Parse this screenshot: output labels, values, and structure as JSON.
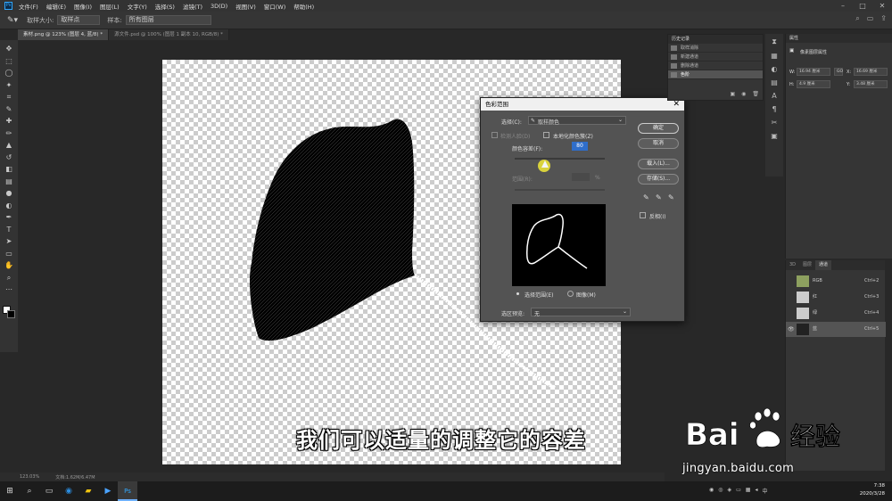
{
  "app": {
    "logo": "Ps",
    "menu": [
      "文件(F)",
      "编辑(E)",
      "图像(I)",
      "图层(L)",
      "文字(Y)",
      "选择(S)",
      "滤镜(T)",
      "3D(D)",
      "视图(V)",
      "窗口(W)",
      "帮助(H)"
    ]
  },
  "options_bar": {
    "sample_size_label": "取样大小:",
    "sample_size_value": "取样点",
    "sample_label": "样本:",
    "sample_value": "所有图层"
  },
  "tabs": [
    {
      "label": "素材.png @ 123% (图层 4, 蓝/8) *",
      "active": true
    },
    {
      "label": "源文件.psd @ 100% (图层 1 副本 10, RGB/8) *",
      "active": false
    }
  ],
  "status_bar": {
    "zoom": "123.03%",
    "doc": "文档:1.62M/6.47M"
  },
  "canvas": {
    "subtitle": "我们可以适量的调整它的容差"
  },
  "dialog": {
    "title": "色彩范围",
    "select_label": "选择(C):",
    "select_value": "取样颜色",
    "detect_faces": "检测人脸(D)",
    "localized": "本地化颜色簇(Z)",
    "fuzziness_label": "颜色容差(F):",
    "fuzziness_value": "80",
    "range_label": "范围(R):",
    "range_unit": "%",
    "radio_selection": "选择范围(E)",
    "radio_image": "图像(M)",
    "preview_label": "选区预览:",
    "preview_value": "无",
    "btn_ok": "确定",
    "btn_cancel": "取消",
    "btn_load": "载入(L)...",
    "btn_save": "存储(S)...",
    "invert": "反相(I)"
  },
  "history": {
    "title": "历史记录",
    "items": [
      "取样消除",
      "新建通道",
      "删除通道",
      "色阶"
    ],
    "selected_index": 3
  },
  "properties": {
    "title": "属性",
    "subtitle": "像素图层属性",
    "w": "16.94 厘米",
    "h": "4.9 厘米",
    "x": "16.69 厘米",
    "y": "3.48 厘米",
    "link": "GO"
  },
  "channels": {
    "tabs": [
      "3D",
      "图层",
      "通道"
    ],
    "active_tab": 2,
    "rows": [
      {
        "name": "RGB",
        "shortcut": "Ctrl+2"
      },
      {
        "name": "红",
        "shortcut": "Ctrl+3"
      },
      {
        "name": "绿",
        "shortcut": "Ctrl+4"
      },
      {
        "name": "蓝",
        "shortcut": "Ctrl+5"
      }
    ],
    "selected_index": 3
  },
  "taskbar": {
    "time": "7:38",
    "date": "2020/3/28",
    "ime": "中"
  },
  "watermark": {
    "text": "jingyan.baidu.com",
    "brand": "Bai",
    "brand2": "经验"
  }
}
